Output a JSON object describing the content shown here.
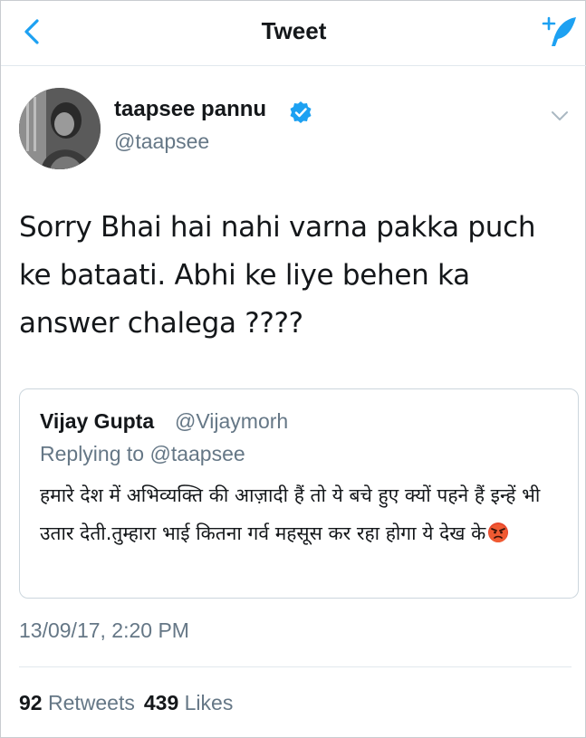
{
  "header": {
    "title": "Tweet",
    "back_icon": "chevron-left-icon",
    "compose_icon": "compose-feather-icon",
    "accent_color": "#1da1f2"
  },
  "tweet": {
    "author_name": "taapsee pannu",
    "author_handle": "@taapsee",
    "verified": true,
    "text": "Sorry Bhai hai nahi varna pakka puch ke bataati. Abhi ke liye behen ka answer chalega ????",
    "timestamp": "13/09/17, 2:20 PM",
    "retweets_count": "92",
    "retweets_label": "Retweets",
    "likes_count": "439",
    "likes_label": "Likes"
  },
  "quoted_tweet": {
    "author_name": "Vijay Gupta",
    "author_handle": "@Vijaymorh",
    "replying_label": "Replying to",
    "replying_handle": "@taapsee",
    "text": "हमारे देश में अभिव्यक्ति की आज़ादी हैं तो ये बचे हुए क्यों पहने हैं इन्हें भी उतार देती.तुम्हारा भाई कितना गर्व महसूस कर रहा होगा ये देख के",
    "emoji": "angry-face-icon"
  }
}
